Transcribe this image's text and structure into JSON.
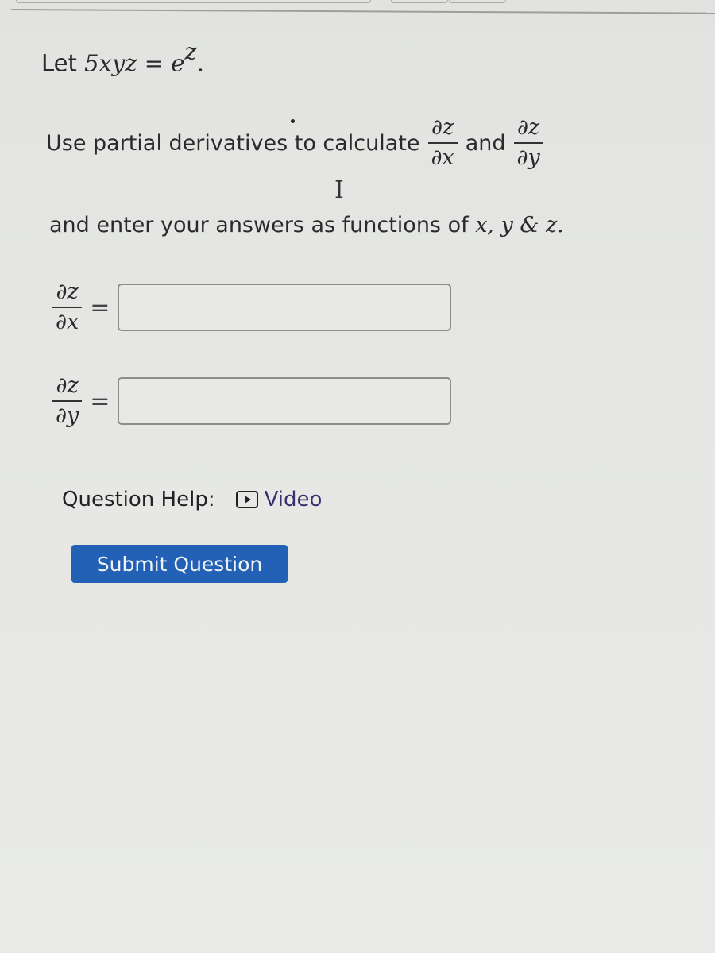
{
  "problem": {
    "intro_label": "Let",
    "equation_lhs": "5xyz",
    "equation_eq": "=",
    "equation_rhs_base": "e",
    "equation_rhs_exp": "z",
    "equation_end": "."
  },
  "instructions": {
    "line1_text": "Use partial derivatives to calculate",
    "frac1_num": "∂z",
    "frac1_den": "∂x",
    "connector": "and",
    "frac2_num": "∂z",
    "frac2_den": "∂y",
    "line2_text": "and enter your answers as functions of",
    "line2_vars": "x, y  &  z."
  },
  "answers": [
    {
      "label_num": "∂z",
      "label_den": "∂x",
      "equals": "=",
      "value": "",
      "placeholder": ""
    },
    {
      "label_num": "∂z",
      "label_den": "∂y",
      "equals": "=",
      "value": "",
      "placeholder": ""
    }
  ],
  "help": {
    "label": "Question Help:",
    "icon": "video-play-icon",
    "link_label": "Video"
  },
  "submit": {
    "label": "Submit Question",
    "color": "#2261b5"
  },
  "cursor": {
    "icon": "text-ibeam-cursor",
    "glyph": "I"
  }
}
